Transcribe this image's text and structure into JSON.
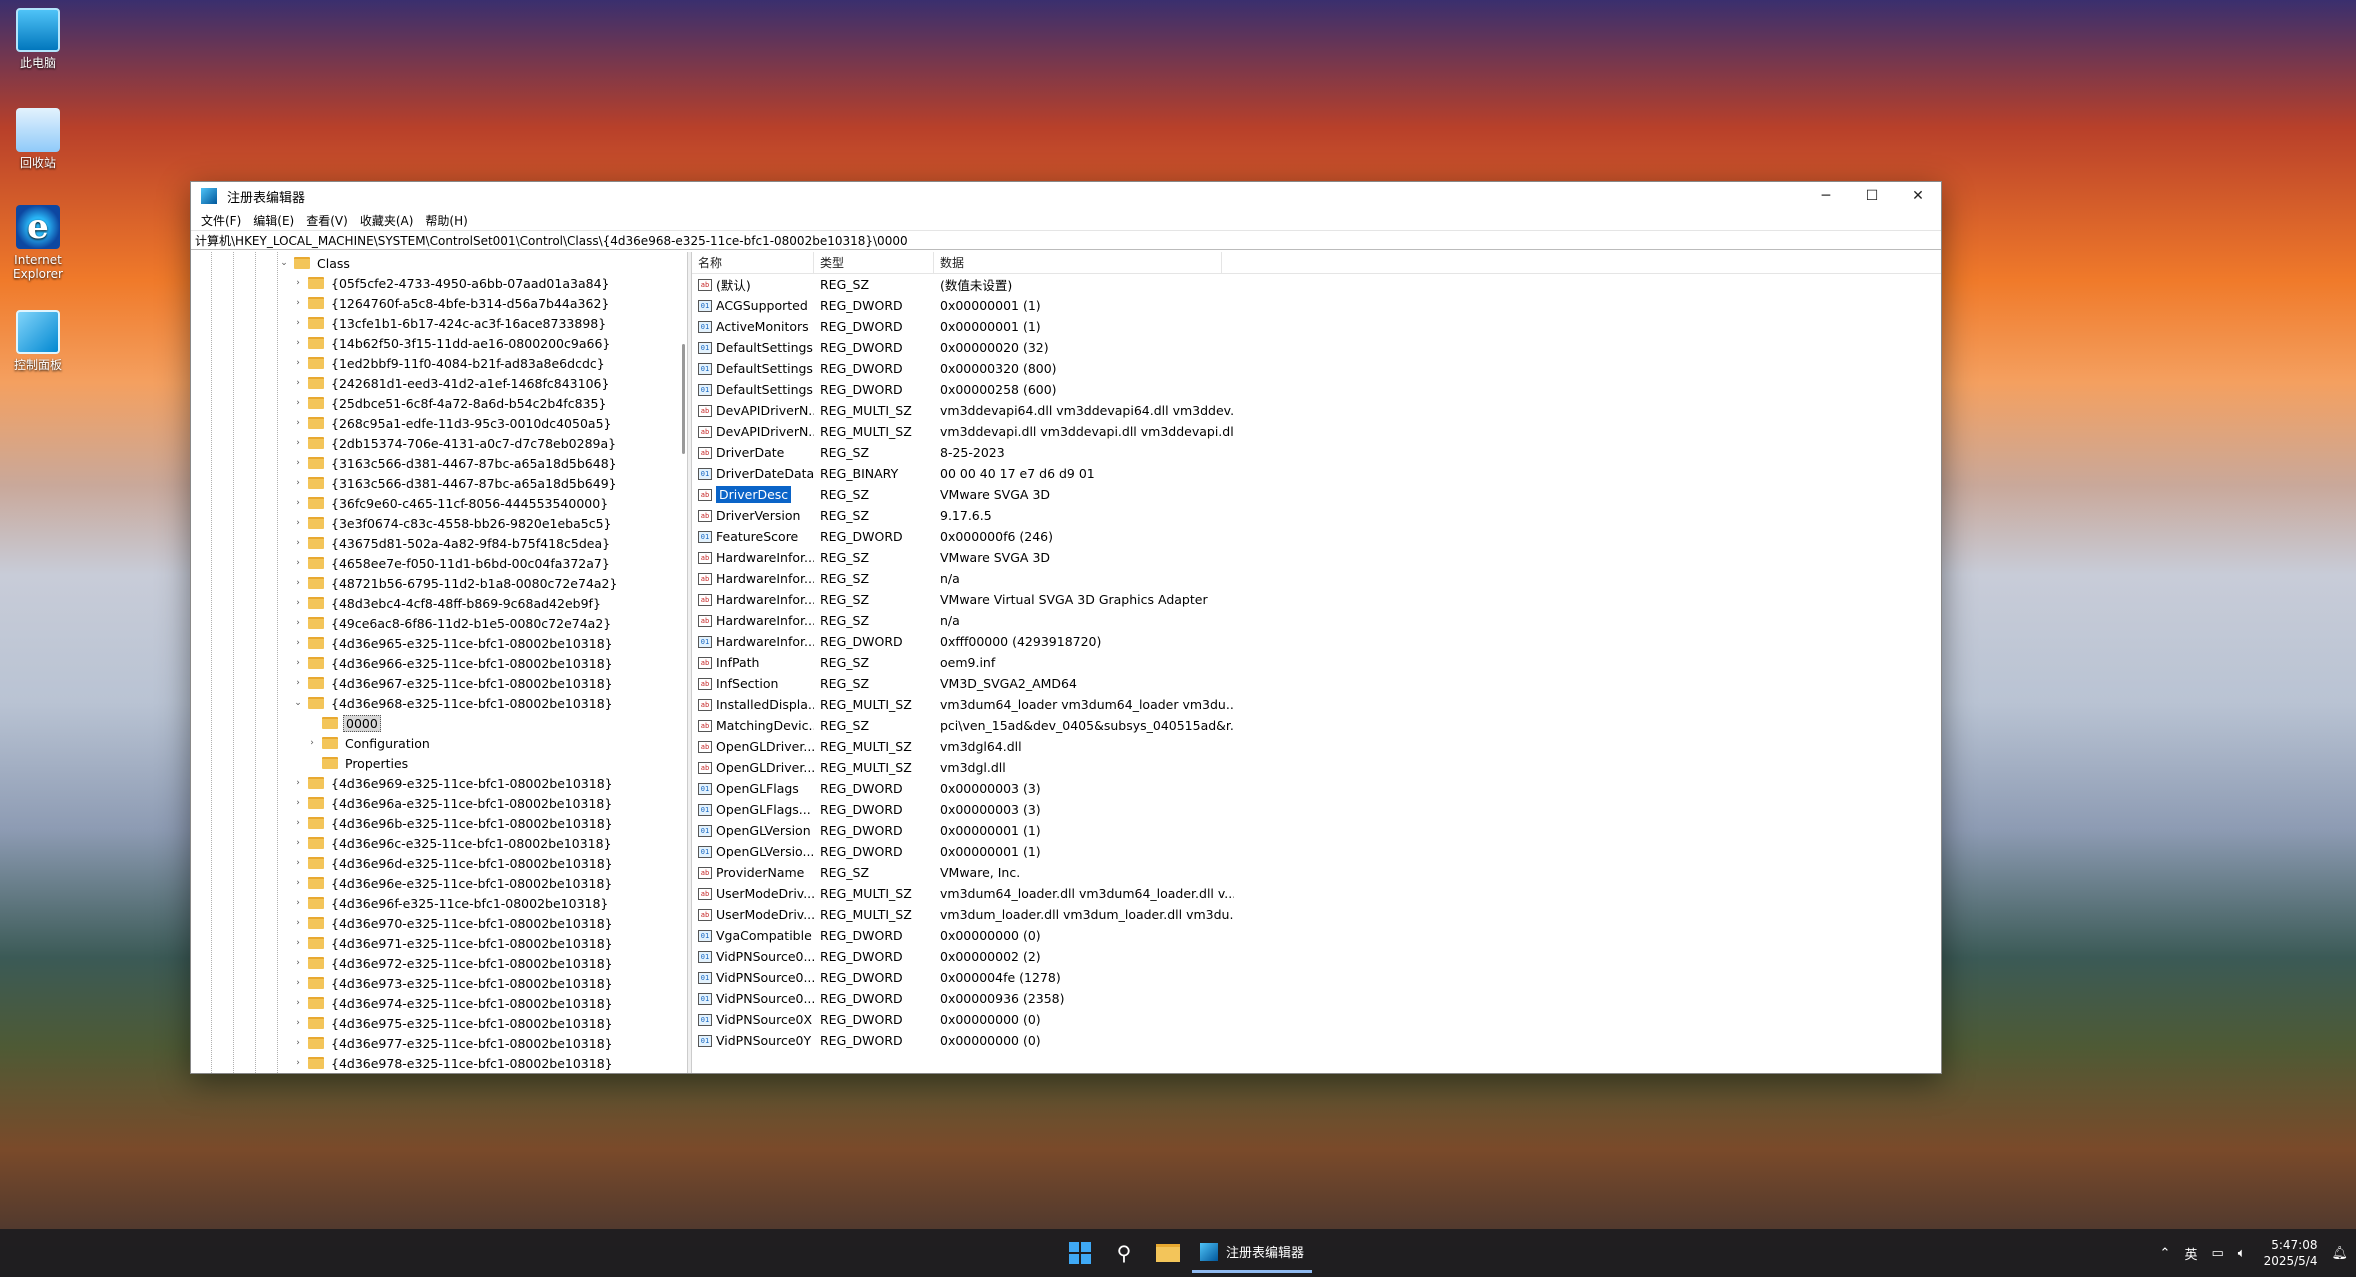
{
  "desktop": {
    "icons": [
      {
        "label": "此电脑",
        "icon": "computer-icon"
      },
      {
        "label": "回收站",
        "icon": "recycle-bin-icon"
      },
      {
        "label": "Internet Explorer",
        "icon": "ie-icon"
      },
      {
        "label": "控制面板",
        "icon": "control-panel-icon"
      }
    ]
  },
  "window": {
    "title": "注册表编辑器",
    "controls": {
      "minimize": "─",
      "maximize": "☐",
      "close": "✕"
    },
    "menu": [
      "文件(F)",
      "编辑(E)",
      "查看(V)",
      "收藏夹(A)",
      "帮助(H)"
    ],
    "address": "计算机\\HKEY_LOCAL_MACHINE\\SYSTEM\\ControlSet001\\Control\\Class\\{4d36e968-e325-11ce-bfc1-08002be10318}\\0000"
  },
  "tree": {
    "root": "Class",
    "items_before": [
      "{05f5cfe2-4733-4950-a6bb-07aad01a3a84}",
      "{1264760f-a5c8-4bfe-b314-d56a7b44a362}",
      "{13cfe1b1-6b17-424c-ac3f-16ace8733898}",
      "{14b62f50-3f15-11dd-ae16-0800200c9a66}",
      "{1ed2bbf9-11f0-4084-b21f-ad83a8e6dcdc}",
      "{242681d1-eed3-41d2-a1ef-1468fc843106}",
      "{25dbce51-6c8f-4a72-8a6d-b54c2b4fc835}",
      "{268c95a1-edfe-11d3-95c3-0010dc4050a5}",
      "{2db15374-706e-4131-a0c7-d7c78eb0289a}",
      "{3163c566-d381-4467-87bc-a65a18d5b648}",
      "{3163c566-d381-4467-87bc-a65a18d5b649}",
      "{36fc9e60-c465-11cf-8056-444553540000}",
      "{3e3f0674-c83c-4558-bb26-9820e1eba5c5}",
      "{43675d81-502a-4a82-9f84-b75f418c5dea}",
      "{4658ee7e-f050-11d1-b6bd-00c04fa372a7}",
      "{48721b56-6795-11d2-b1a8-0080c72e74a2}",
      "{48d3ebc4-4cf8-48ff-b869-9c68ad42eb9f}",
      "{49ce6ac8-6f86-11d2-b1e5-0080c72e74a2}",
      "{4d36e965-e325-11ce-bfc1-08002be10318}",
      "{4d36e966-e325-11ce-bfc1-08002be10318}",
      "{4d36e967-e325-11ce-bfc1-08002be10318}"
    ],
    "expanded": "{4d36e968-e325-11ce-bfc1-08002be10318}",
    "children": [
      "0000",
      "Configuration",
      "Properties"
    ],
    "items_after": [
      "{4d36e969-e325-11ce-bfc1-08002be10318}",
      "{4d36e96a-e325-11ce-bfc1-08002be10318}",
      "{4d36e96b-e325-11ce-bfc1-08002be10318}",
      "{4d36e96c-e325-11ce-bfc1-08002be10318}",
      "{4d36e96d-e325-11ce-bfc1-08002be10318}",
      "{4d36e96e-e325-11ce-bfc1-08002be10318}",
      "{4d36e96f-e325-11ce-bfc1-08002be10318}",
      "{4d36e970-e325-11ce-bfc1-08002be10318}",
      "{4d36e971-e325-11ce-bfc1-08002be10318}",
      "{4d36e972-e325-11ce-bfc1-08002be10318}",
      "{4d36e973-e325-11ce-bfc1-08002be10318}",
      "{4d36e974-e325-11ce-bfc1-08002be10318}",
      "{4d36e975-e325-11ce-bfc1-08002be10318}",
      "{4d36e977-e325-11ce-bfc1-08002be10318}",
      "{4d36e978-e325-11ce-bfc1-08002be10318}"
    ]
  },
  "list": {
    "headers": {
      "name": "名称",
      "type": "类型",
      "data": "数据"
    },
    "rows": [
      {
        "name": "(默认)",
        "type": "REG_SZ",
        "data": "(数值未设置)"
      },
      {
        "name": "ACGSupported",
        "type": "REG_DWORD",
        "data": "0x00000001 (1)"
      },
      {
        "name": "ActiveMonitors",
        "type": "REG_DWORD",
        "data": "0x00000001 (1)"
      },
      {
        "name": "DefaultSettings....",
        "type": "REG_DWORD",
        "data": "0x00000020 (32)"
      },
      {
        "name": "DefaultSettings....",
        "type": "REG_DWORD",
        "data": "0x00000320 (800)"
      },
      {
        "name": "DefaultSettings....",
        "type": "REG_DWORD",
        "data": "0x00000258 (600)"
      },
      {
        "name": "DevAPIDriverN...",
        "type": "REG_MULTI_SZ",
        "data": "vm3ddevapi64.dll vm3ddevapi64.dll vm3ddev..."
      },
      {
        "name": "DevAPIDriverN...",
        "type": "REG_MULTI_SZ",
        "data": "vm3ddevapi.dll vm3ddevapi.dll vm3ddevapi.dll"
      },
      {
        "name": "DriverDate",
        "type": "REG_SZ",
        "data": "8-25-2023"
      },
      {
        "name": "DriverDateData",
        "type": "REG_BINARY",
        "data": "00 00 40 17 e7 d6 d9 01"
      },
      {
        "name": "DriverDesc",
        "type": "REG_SZ",
        "data": "VMware SVGA 3D"
      },
      {
        "name": "DriverVersion",
        "type": "REG_SZ",
        "data": "9.17.6.5"
      },
      {
        "name": "FeatureScore",
        "type": "REG_DWORD",
        "data": "0x000000f6 (246)"
      },
      {
        "name": "HardwareInfor...",
        "type": "REG_SZ",
        "data": "VMware SVGA 3D"
      },
      {
        "name": "HardwareInfor...",
        "type": "REG_SZ",
        "data": "n/a"
      },
      {
        "name": "HardwareInfor...",
        "type": "REG_SZ",
        "data": "VMware Virtual SVGA 3D Graphics Adapter"
      },
      {
        "name": "HardwareInfor...",
        "type": "REG_SZ",
        "data": "n/a"
      },
      {
        "name": "HardwareInfor...",
        "type": "REG_DWORD",
        "data": "0xfff00000 (4293918720)"
      },
      {
        "name": "InfPath",
        "type": "REG_SZ",
        "data": "oem9.inf"
      },
      {
        "name": "InfSection",
        "type": "REG_SZ",
        "data": "VM3D_SVGA2_AMD64"
      },
      {
        "name": "InstalledDispla...",
        "type": "REG_MULTI_SZ",
        "data": "vm3dum64_loader vm3dum64_loader vm3du..."
      },
      {
        "name": "MatchingDevic...",
        "type": "REG_SZ",
        "data": "pci\\ven_15ad&dev_0405&subsys_040515ad&r..."
      },
      {
        "name": "OpenGLDriver...",
        "type": "REG_MULTI_SZ",
        "data": "vm3dgl64.dll"
      },
      {
        "name": "OpenGLDriver...",
        "type": "REG_MULTI_SZ",
        "data": "vm3dgl.dll"
      },
      {
        "name": "OpenGLFlags",
        "type": "REG_DWORD",
        "data": "0x00000003 (3)"
      },
      {
        "name": "OpenGLFlags...",
        "type": "REG_DWORD",
        "data": "0x00000003 (3)"
      },
      {
        "name": "OpenGLVersion",
        "type": "REG_DWORD",
        "data": "0x00000001 (1)"
      },
      {
        "name": "OpenGLVersio...",
        "type": "REG_DWORD",
        "data": "0x00000001 (1)"
      },
      {
        "name": "ProviderName",
        "type": "REG_SZ",
        "data": "VMware, Inc."
      },
      {
        "name": "UserModeDriv...",
        "type": "REG_MULTI_SZ",
        "data": "vm3dum64_loader.dll vm3dum64_loader.dll v..."
      },
      {
        "name": "UserModeDriv...",
        "type": "REG_MULTI_SZ",
        "data": "vm3dum_loader.dll vm3dum_loader.dll vm3du..."
      },
      {
        "name": "VgaCompatible",
        "type": "REG_DWORD",
        "data": "0x00000000 (0)"
      },
      {
        "name": "VidPNSource0...",
        "type": "REG_DWORD",
        "data": "0x00000002 (2)"
      },
      {
        "name": "VidPNSource0...",
        "type": "REG_DWORD",
        "data": "0x000004fe (1278)"
      },
      {
        "name": "VidPNSource0...",
        "type": "REG_DWORD",
        "data": "0x00000936 (2358)"
      },
      {
        "name": "VidPNSource0X",
        "type": "REG_DWORD",
        "data": "0x00000000 (0)"
      },
      {
        "name": "VidPNSource0Y",
        "type": "REG_DWORD",
        "data": "0x00000000 (0)"
      }
    ],
    "selected_index": 10
  },
  "taskbar": {
    "app_label": "注册表编辑器",
    "tray": {
      "ime": "英",
      "time": "5:47:08",
      "date": "2025/5/4"
    }
  }
}
